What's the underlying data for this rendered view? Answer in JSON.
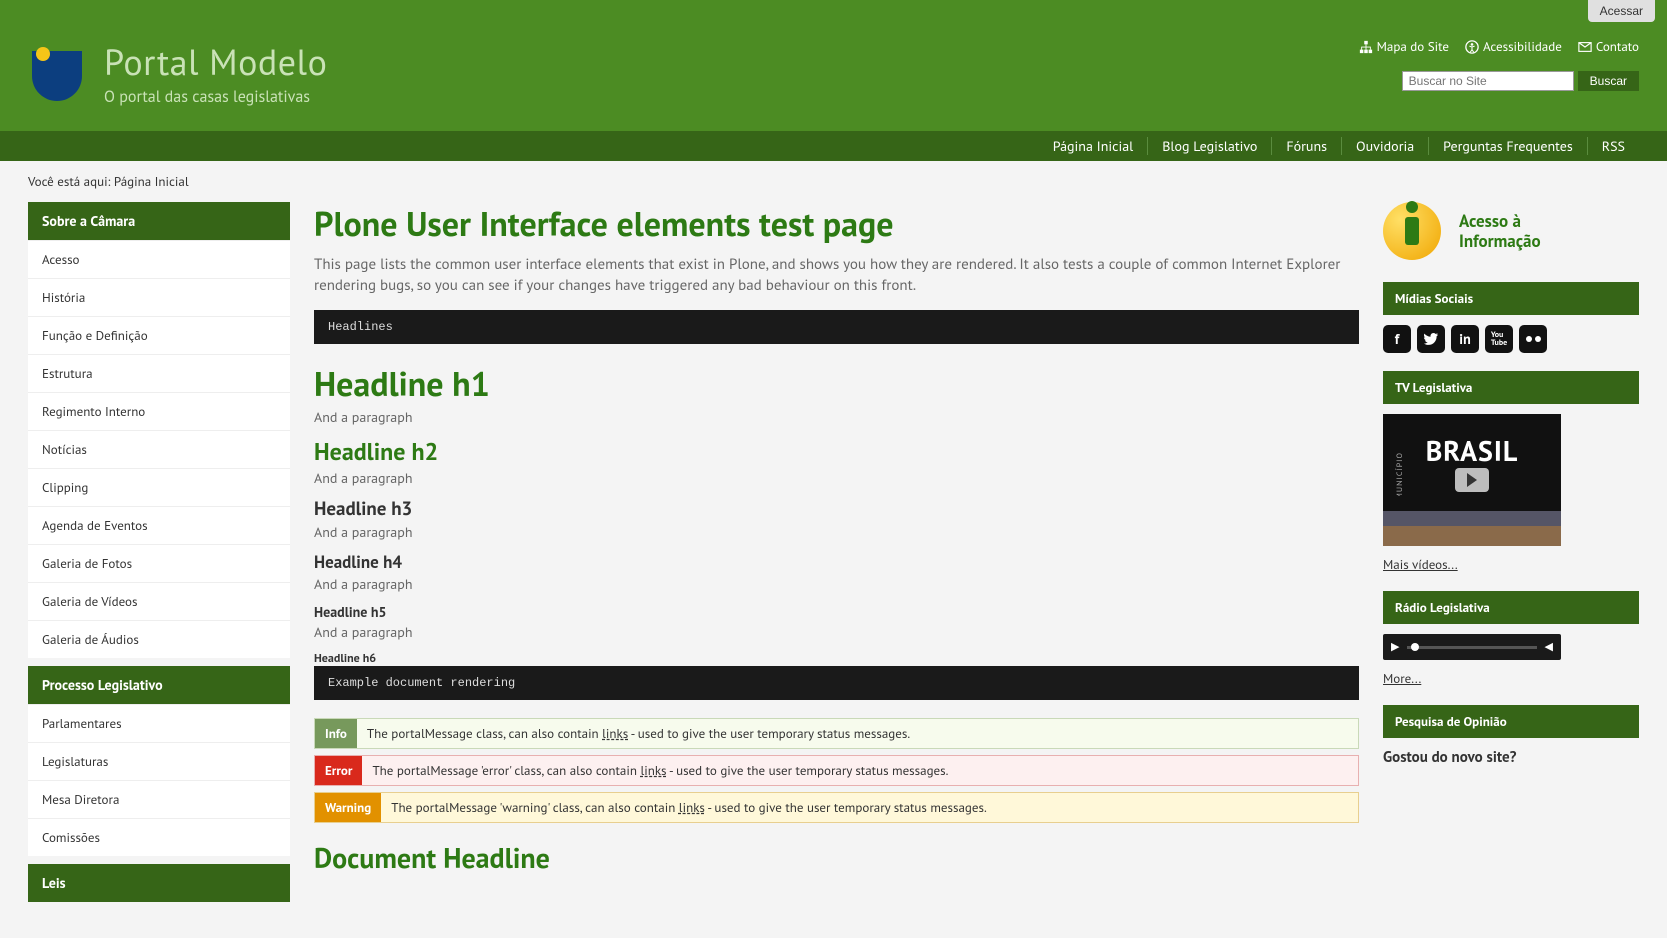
{
  "access_btn": "Acessar",
  "site": {
    "title": "Portal Modelo",
    "subtitle": "O portal das casas legislativas"
  },
  "header_links": {
    "sitemap": "Mapa do Site",
    "accessibility": "Acessibilidade",
    "contact": "Contato"
  },
  "search": {
    "placeholder": "Buscar no Site",
    "button": "Buscar"
  },
  "main_nav": [
    "Página Inicial",
    "Blog Legislativo",
    "Fóruns",
    "Ouvidoria",
    "Perguntas Frequentes",
    "RSS"
  ],
  "breadcrumb": {
    "prefix": "Você está aqui: ",
    "home": "Página Inicial"
  },
  "sidebar": {
    "section1": {
      "title": "Sobre a Câmara",
      "items": [
        "Acesso",
        "História",
        "Função e Definição",
        "Estrutura",
        "Regimento Interno",
        "Notícias",
        "Clipping",
        "Agenda de Eventos",
        "Galeria de Fotos",
        "Galeria de Vídeos",
        "Galeria de Áudios"
      ]
    },
    "section2": {
      "title": "Processo Legislativo",
      "items": [
        "Parlamentares",
        "Legislaturas",
        "Mesa Diretora",
        "Comissões"
      ]
    },
    "section3": {
      "title": "Leis"
    }
  },
  "page": {
    "title": "Plone User Interface elements test page",
    "description": "This page lists the common user interface elements that exist in Plone, and shows you how they are rendered. It also tests a couple of common Internet Explorer rendering bugs, so you can see if your changes have triggered any bad behaviour on this front.",
    "code1": "Headlines",
    "h1": "Headline h1",
    "p1": "And a paragraph",
    "h2": "Headline h2",
    "p2": "And a paragraph",
    "h3": "Headline h3",
    "p3": "And a paragraph",
    "h4": "Headline h4",
    "p4": "And a paragraph",
    "h5": "Headline h5",
    "p5": "And a paragraph",
    "h6": "Headline h6",
    "code2": "Example document rendering",
    "msg_info": {
      "label": "Info",
      "pre": "The portalMessage class, can also contain ",
      "link": "links",
      "post": " - used to give the user temporary status messages."
    },
    "msg_error": {
      "label": "Error",
      "pre": "The portalMessage 'error' class, can also contain ",
      "link": "links",
      "post": " - used to give the user temporary status messages."
    },
    "msg_warning": {
      "label": "Warning",
      "pre": "The portalMessage 'warning' class, can also contain ",
      "link": "links",
      "post": " - used to give the user temporary status messages."
    },
    "doc_headline": "Document Headline"
  },
  "right": {
    "info_access": {
      "line1": "Acesso à",
      "line2": "Informação"
    },
    "social_title": "Mídias Sociais",
    "tv_title": "TV Legislativa",
    "tv_brand": "BRASIL",
    "tv_munic": "MUNICÍPIO",
    "more_videos": "Mais vídeos...",
    "radio_title": "Rádio Legislativa",
    "more": "More...",
    "poll_title": "Pesquisa de Opinião",
    "poll_question": "Gostou do novo site?"
  }
}
